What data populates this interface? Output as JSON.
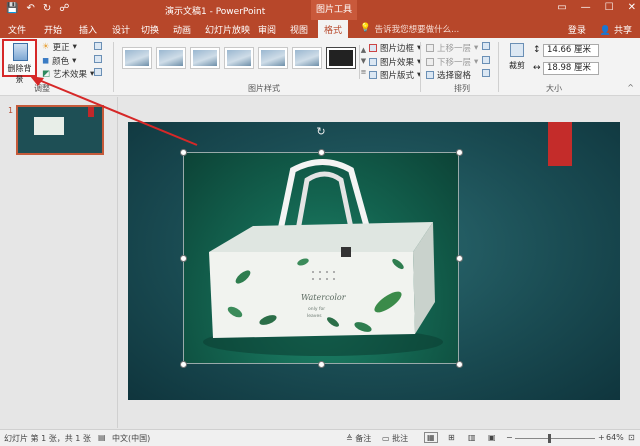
{
  "titlebar": {
    "title": "演示文稿1 - PowerPoint",
    "context_tab_group": "图片工具",
    "qat": {
      "save": "💾",
      "undo": "↶",
      "redo": "↻",
      "custom": "☍"
    }
  },
  "tabs": [
    "文件",
    "开始",
    "插入",
    "设计",
    "切换",
    "动画",
    "幻灯片放映",
    "审阅",
    "视图",
    "格式"
  ],
  "tell_me": "告诉我您想要做什么...",
  "account": {
    "signin": "登录",
    "share": "共享"
  },
  "ribbon": {
    "adjust": {
      "remove_bg": "删除背景",
      "corrections": "更正",
      "color": "颜色",
      "artistic": "艺术效果",
      "label": "调整"
    },
    "styles": {
      "label": "图片样式"
    },
    "style_commands": {
      "border": "图片边框",
      "effects": "图片效果",
      "layout": "图片版式"
    },
    "arrange": {
      "bring_forward": "上移一层",
      "send_backward": "下移一层",
      "selection_pane": "选择窗格",
      "label": "排列"
    },
    "size": {
      "crop": "裁剪",
      "height": "14.66 厘米",
      "width": "18.98 厘米",
      "label": "大小"
    }
  },
  "slides": {
    "number": "1"
  },
  "statusbar": {
    "slide_info": "幻灯片 第 1 张，共 1 张",
    "language": "中文(中国)",
    "notes": "备注",
    "comments": "批注",
    "zoom": "64%"
  },
  "product": {
    "brand": "Watercolor",
    "line1": "only for",
    "line2": "leaves"
  },
  "colors": {
    "accent": "#b7472a",
    "highlight": "#d62828",
    "slide_bg": "#1a4c53",
    "photo_bg": "#13634f"
  }
}
